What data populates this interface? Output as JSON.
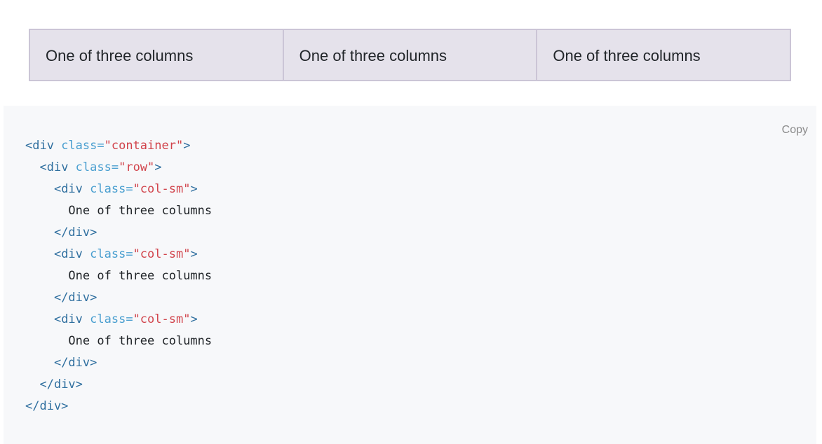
{
  "example": {
    "columns": [
      "One of three columns",
      "One of three columns",
      "One of three columns"
    ]
  },
  "code_block": {
    "copy_label": "Copy",
    "lines": [
      {
        "indent": "",
        "open": "<div",
        "attr": " class=",
        "val": "\"container\"",
        "close": ">",
        "text": ""
      },
      {
        "indent": "  ",
        "open": "<div",
        "attr": " class=",
        "val": "\"row\"",
        "close": ">",
        "text": ""
      },
      {
        "indent": "    ",
        "open": "<div",
        "attr": " class=",
        "val": "\"col-sm\"",
        "close": ">",
        "text": ""
      },
      {
        "indent": "      ",
        "open": "",
        "attr": "",
        "val": "",
        "close": "",
        "text": "One of three columns"
      },
      {
        "indent": "    ",
        "open": "</div>",
        "attr": "",
        "val": "",
        "close": "",
        "text": ""
      },
      {
        "indent": "    ",
        "open": "<div",
        "attr": " class=",
        "val": "\"col-sm\"",
        "close": ">",
        "text": ""
      },
      {
        "indent": "      ",
        "open": "",
        "attr": "",
        "val": "",
        "close": "",
        "text": "One of three columns"
      },
      {
        "indent": "    ",
        "open": "</div>",
        "attr": "",
        "val": "",
        "close": "",
        "text": ""
      },
      {
        "indent": "    ",
        "open": "<div",
        "attr": " class=",
        "val": "\"col-sm\"",
        "close": ">",
        "text": ""
      },
      {
        "indent": "      ",
        "open": "",
        "attr": "",
        "val": "",
        "close": "",
        "text": "One of three columns"
      },
      {
        "indent": "    ",
        "open": "</div>",
        "attr": "",
        "val": "",
        "close": "",
        "text": ""
      },
      {
        "indent": "  ",
        "open": "</div>",
        "attr": "",
        "val": "",
        "close": "",
        "text": ""
      },
      {
        "indent": "",
        "open": "</div>",
        "attr": "",
        "val": "",
        "close": "",
        "text": ""
      }
    ]
  },
  "colors": {
    "column_bg": "#e5e2eb",
    "column_border": "#cbc5d6",
    "code_bg": "#f7f8fa",
    "tag": "#2f6f9f",
    "attr": "#4a9fd0",
    "value": "#d1434b"
  }
}
